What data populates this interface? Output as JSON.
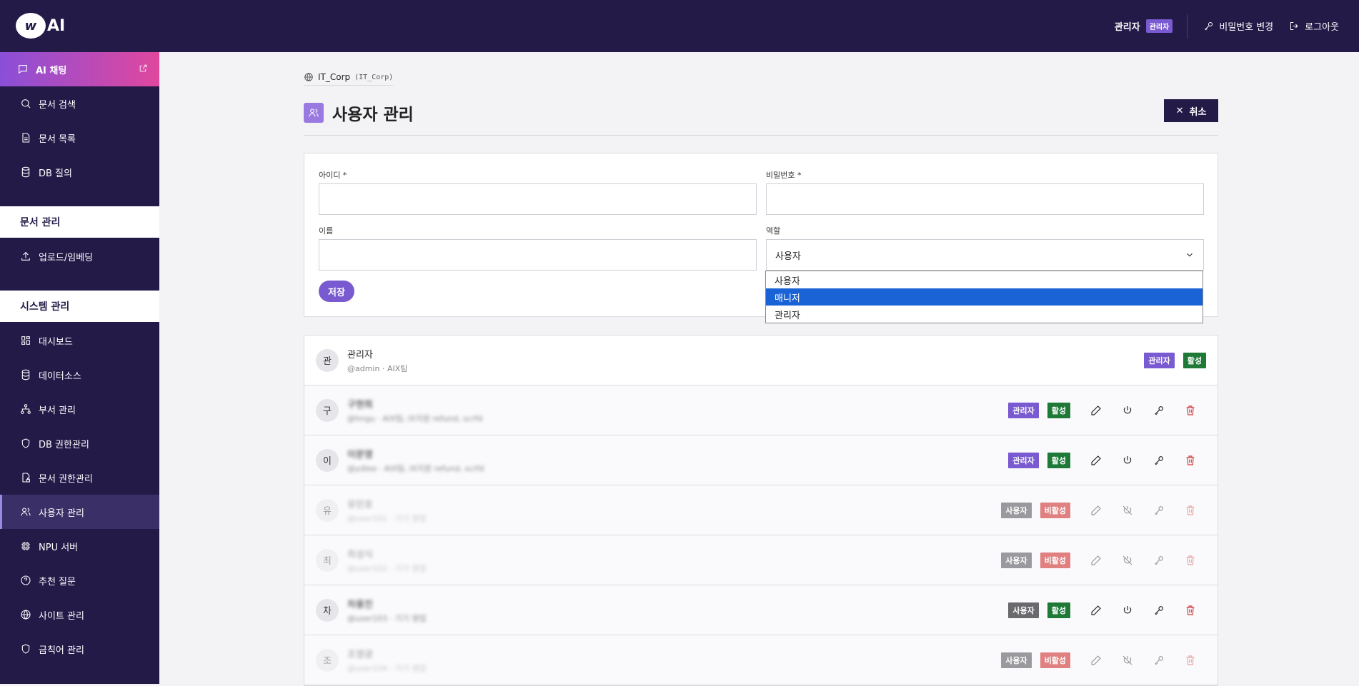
{
  "header": {
    "brand_mark": "w",
    "brand_text": "AI",
    "user_name": "관리자",
    "user_role": "관리자",
    "change_password": "비밀번호 변경",
    "logout": "로그아웃"
  },
  "sidebar": {
    "ai_chat": "AI 채팅",
    "items_top": [
      "문서 검색",
      "문서 목록",
      "DB 질의"
    ],
    "section_docs": "문서 관리",
    "items_docs": [
      "업로드/임베딩"
    ],
    "section_system": "시스템 관리",
    "items_system": [
      "대시보드",
      "데이터소스",
      "부서 관리",
      "DB 권한관리",
      "문서 권한관리",
      "사용자 관리",
      "NPU 서버",
      "추천 질문",
      "사이트 관리",
      "금칙어 관리"
    ]
  },
  "breadcrumb": {
    "site": "IT_Corp",
    "code": "(IT_Corp)"
  },
  "page": {
    "title": "사용자 관리",
    "cancel": "취소"
  },
  "form": {
    "id_label": "아이디 *",
    "password_label": "비밀번호 *",
    "name_label": "이름",
    "role_label": "역할",
    "role_value": "사용자",
    "role_options": [
      "사용자",
      "매니저",
      "관리자"
    ],
    "save": "저장"
  },
  "users": [
    {
      "initial": "관",
      "name": "관리자",
      "sub": "@admin · AIX팀",
      "role": "관리자",
      "status": "활성"
    },
    {
      "initial": "구",
      "name": "구현희",
      "sub": "@hngu · AIX팀, IX지원 refund, scrfd",
      "role": "관리자",
      "status": "활성"
    },
    {
      "initial": "이",
      "name": "이문영",
      "sub": "@ydlee · AIX팀, IX지원 refund, scrfd",
      "role": "관리자",
      "status": "활성"
    },
    {
      "initial": "유",
      "name": "유민호",
      "sub": "@user101 · 기기 영업",
      "role": "사용자",
      "status": "비활성"
    },
    {
      "initial": "최",
      "name": "최성식",
      "sub": "@user102 · 기기 영업",
      "role": "사용자",
      "status": "비활성"
    },
    {
      "initial": "차",
      "name": "차용진",
      "sub": "@user103 · 기기 영업",
      "role": "사용자",
      "status": "활성"
    },
    {
      "initial": "조",
      "name": "조영광",
      "sub": "@user104 · 기기 영업",
      "role": "사용자",
      "status": "비활성"
    }
  ]
}
